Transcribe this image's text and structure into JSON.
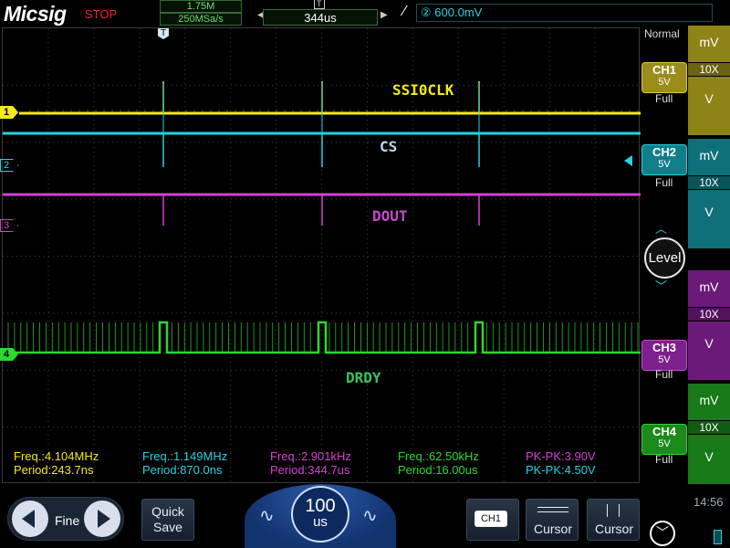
{
  "brand": {
    "logo": "Micsig",
    "run_state": "STOP"
  },
  "acquisition": {
    "memory_depth": "1.75M",
    "sample_rate": "250MSa/s"
  },
  "trigger": {
    "delay": "344us",
    "edge_symbol": "∕",
    "source_badge": "②",
    "level": "600.0mV",
    "mode": "Normal"
  },
  "channels": [
    {
      "id": "CH1",
      "label": "SSI0CLK",
      "scale": "5V",
      "bw": "Full",
      "unit": "mV",
      "probe": "10X",
      "unit2": "V",
      "marker": "1",
      "color": "#f4ea1b"
    },
    {
      "id": "CH2",
      "label": "CS",
      "scale": "5V",
      "bw": "Full",
      "unit": "mV",
      "probe": "10X",
      "unit2": "V",
      "marker": "2",
      "color": "#27d1e3"
    },
    {
      "id": "CH3",
      "label": "DOUT",
      "scale": "5V",
      "bw": "Full",
      "unit": "mV",
      "probe": "10X",
      "unit2": "V",
      "marker": "3",
      "color": "#d63fd6"
    },
    {
      "id": "CH4",
      "label": "DRDY",
      "scale": "5V",
      "bw": "Full",
      "unit": "mV",
      "probe": "10X",
      "unit2": "V",
      "marker": "4",
      "color": "#2ed82e"
    }
  ],
  "measurements": [
    {
      "line1": "Freq.:4.104MHz",
      "line2": "Period:243.7ns",
      "color": "#f4ea1b"
    },
    {
      "line1": "Freq.:1.149MHz",
      "line2": "Period:870.0ns",
      "color": "#27d1e3"
    },
    {
      "line1": "Freq.:2.901kHz",
      "line2": "Period:344.7us",
      "color": "#d63fd6"
    },
    {
      "line1": "Freq.:62.50kHz",
      "line2": "Period:16.00us",
      "color": "#2ed82e"
    },
    {
      "line1": "PK-PK:3.90V",
      "line2": "PK-PK:4.50V",
      "color": "#d63fd6",
      "color2": "#27d1e3"
    }
  ],
  "controls": {
    "level_knob": "Level",
    "fine": "Fine",
    "quick_save": "Quick\nSave",
    "timebase_value": "100",
    "timebase_unit": "us",
    "ch_select": "CH1",
    "cursor1": "Cursor",
    "cursor2": "Cursor"
  },
  "status": {
    "time": "14:56"
  }
}
